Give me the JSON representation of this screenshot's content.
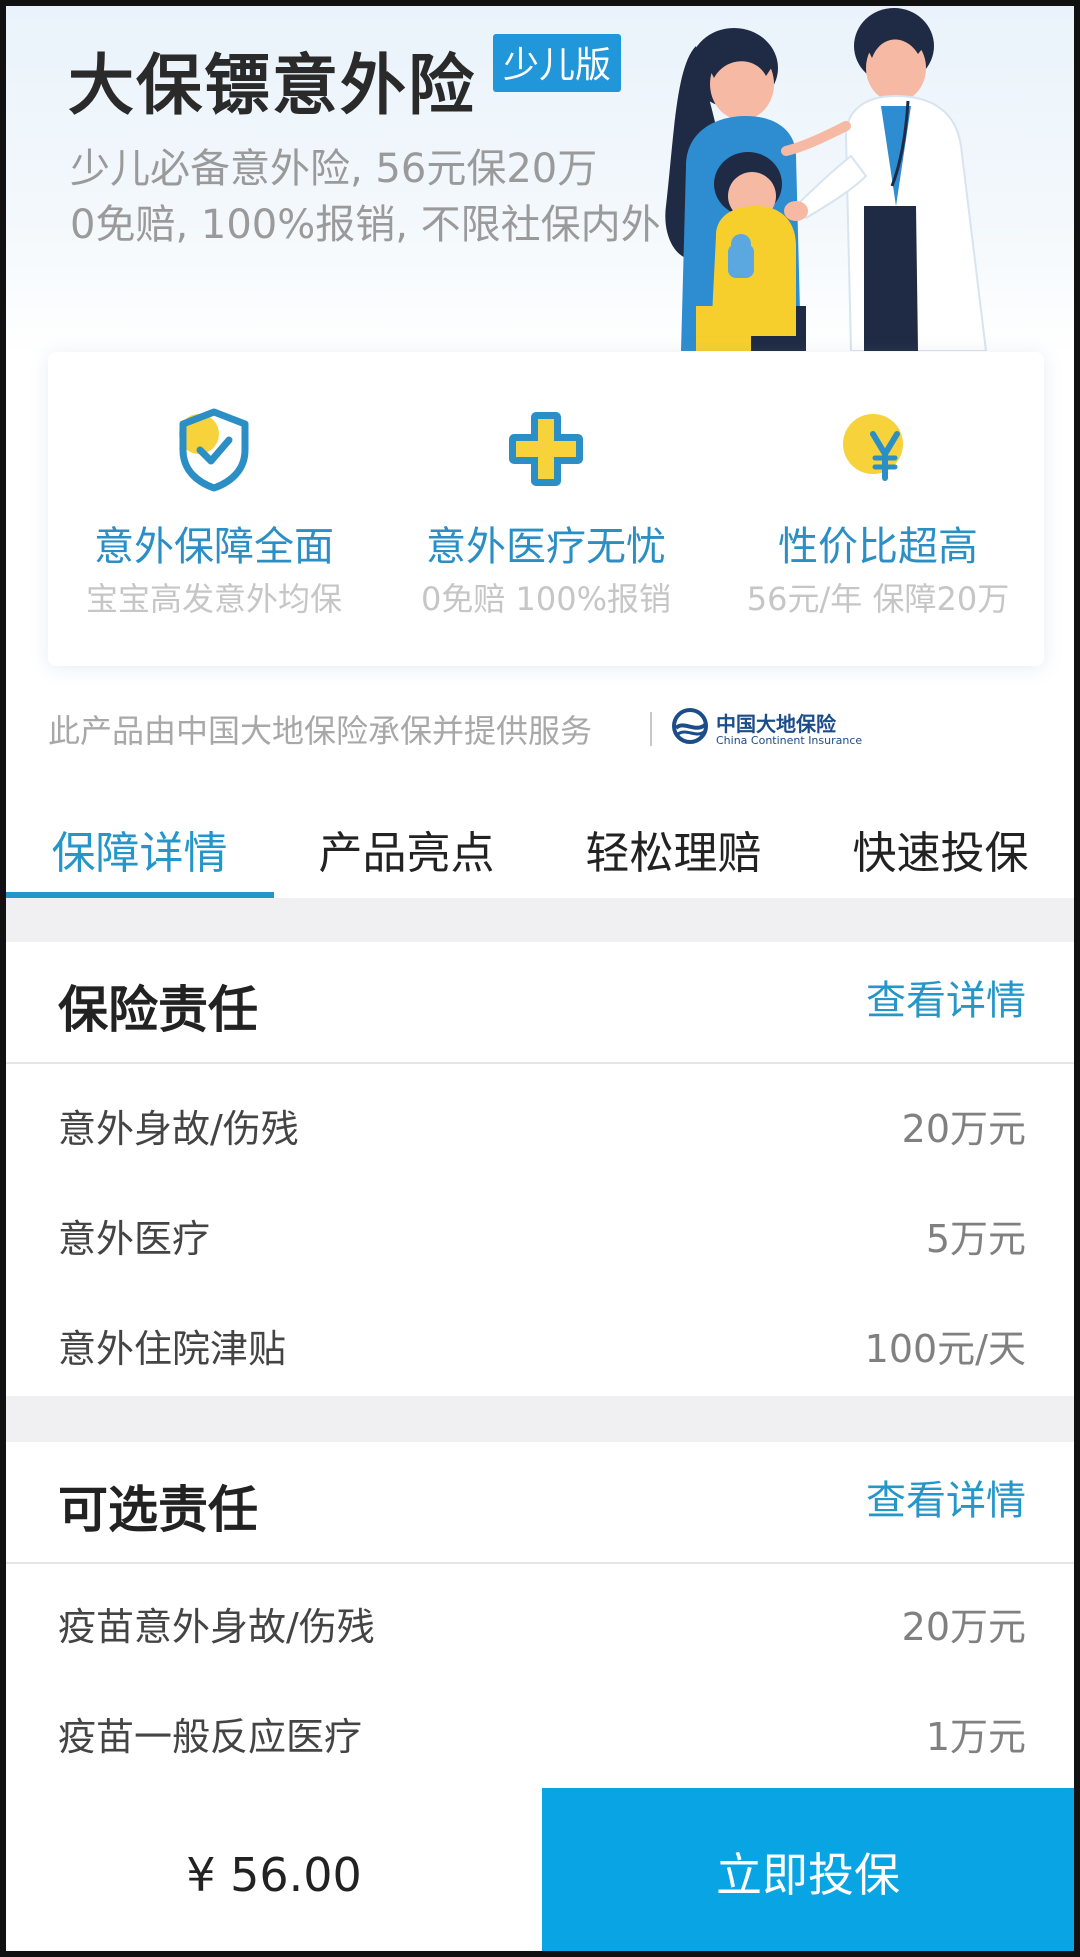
{
  "hero": {
    "title": "大保镖意外险",
    "badge": "少儿版",
    "subtitle_line1": "少儿必备意外险, 56元保20万",
    "subtitle_line2": "0免赔, 100%报销, 不限社保内外"
  },
  "features": [
    {
      "icon": "shield-check-icon",
      "title": "意外保障全面",
      "subtitle": "宝宝高发意外均保"
    },
    {
      "icon": "medical-cross-icon",
      "title": "意外医疗无忧",
      "subtitle": "0免赔 100%报销"
    },
    {
      "icon": "yuan-coin-icon",
      "title": "性价比超高",
      "subtitle": "56元/年 保障20万"
    }
  ],
  "underwriter": {
    "text": "此产品由中国大地保险承保并提供服务",
    "logo_name": "中国大地保险",
    "logo_en": "China Continent Insurance"
  },
  "tabs": [
    {
      "label": "保障详情",
      "active": true
    },
    {
      "label": "产品亮点",
      "active": false
    },
    {
      "label": "轻松理赔",
      "active": false
    },
    {
      "label": "快速投保",
      "active": false
    }
  ],
  "sections": [
    {
      "title": "保险责任",
      "link": "查看详情",
      "rows": [
        {
          "label": "意外身故/伤残",
          "value": "20万元"
        },
        {
          "label": "意外医疗",
          "value": "5万元"
        },
        {
          "label": "意外住院津贴",
          "value": "100元/天"
        }
      ]
    },
    {
      "title": "可选责任",
      "link": "查看详情",
      "rows": [
        {
          "label": "疫苗意外身故/伤残",
          "value": "20万元"
        },
        {
          "label": "疫苗一般反应医疗",
          "value": "1万元"
        }
      ]
    }
  ],
  "bottom": {
    "price": "¥ 56.00",
    "buy_label": "立即投保"
  },
  "colors": {
    "accent": "#2596c9",
    "buy_button": "#09a4e4",
    "badge": "#2196d8",
    "feature_yellow": "#f7d23a"
  }
}
